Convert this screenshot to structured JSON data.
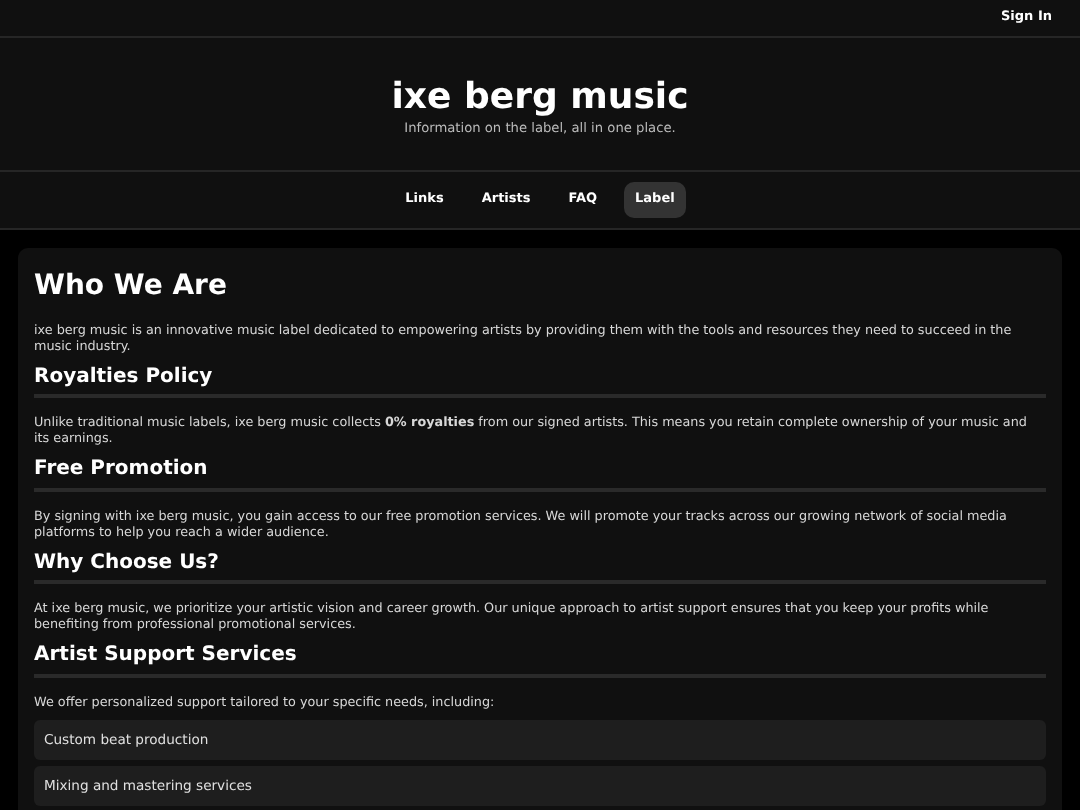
{
  "top_bar": {
    "sign_in": "Sign In"
  },
  "header": {
    "title": "ixe berg music",
    "subtitle": "Information on the label, all in one place."
  },
  "nav": [
    {
      "label": "Links",
      "selected": false
    },
    {
      "label": "Artists",
      "selected": false
    },
    {
      "label": "FAQ",
      "selected": false
    },
    {
      "label": "Label",
      "selected": true
    }
  ],
  "sections": [
    {
      "kind": "title",
      "heading": "Who We Are",
      "paragraph": "ixe berg music is an innovative music label dedicated to empowering artists by providing them with the tools and resources they need to succeed in the music industry."
    },
    {
      "kind": "section",
      "heading": "Royalties Policy",
      "paragraph": "Unlike traditional music labels, ixe berg music collects **0% royalties** from our signed artists. This means you retain complete ownership of your music and its earnings."
    },
    {
      "kind": "section",
      "heading": "Free Promotion",
      "paragraph": "By signing with ixe berg music, you gain access to our free promotion services. We will promote your tracks across our growing network of social media platforms to help you reach a wider audience."
    },
    {
      "kind": "section",
      "heading": "Why Choose Us?",
      "paragraph": "At ixe berg music, we prioritize your artistic vision and career growth. Our unique approach to artist support ensures that you keep your profits while benefiting from professional promotional services."
    },
    {
      "kind": "section",
      "heading": "Artist Support Services",
      "paragraph": "We offer personalized support tailored to your specific needs, including:",
      "items": [
        "Custom beat production",
        "Mixing and mastering services"
      ]
    }
  ]
}
